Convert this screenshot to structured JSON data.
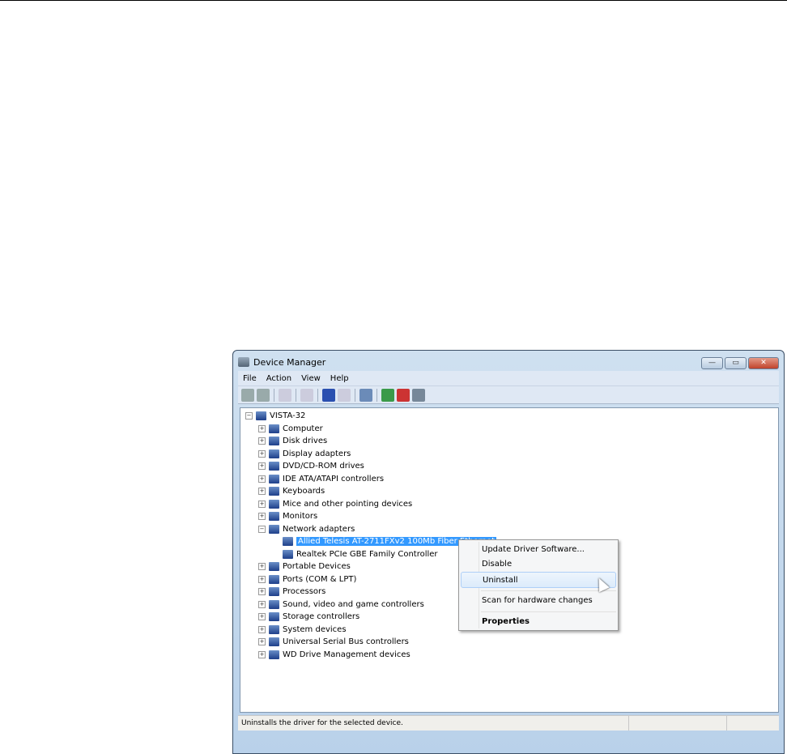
{
  "window": {
    "title": "Device Manager",
    "buttons": [
      "minimize",
      "maximize",
      "close"
    ]
  },
  "menu": [
    "File",
    "Action",
    "View",
    "Help"
  ],
  "toolbar": [
    "back-icon",
    "forward-icon",
    "show-hide-console-tree-icon",
    "properties-icon",
    "help-icon",
    "action-pane-icon",
    "scan-hardware-icon",
    "update-driver-icon",
    "uninstall-icon",
    "disable-icon"
  ],
  "tree": {
    "root": "VISTA-32",
    "items": [
      {
        "label": "Computer",
        "expanded": false
      },
      {
        "label": "Disk drives",
        "expanded": false
      },
      {
        "label": "Display adapters",
        "expanded": false
      },
      {
        "label": "DVD/CD-ROM drives",
        "expanded": false
      },
      {
        "label": "IDE ATA/ATAPI controllers",
        "expanded": false
      },
      {
        "label": "Keyboards",
        "expanded": false
      },
      {
        "label": "Mice and other pointing devices",
        "expanded": false
      },
      {
        "label": "Monitors",
        "expanded": false
      },
      {
        "label": "Network adapters",
        "expanded": true,
        "children": [
          "Allied Telesis AT-2711FXv2 100Mb Fiber Ethernet",
          "Realtek PCIe GBE Family Controller"
        ]
      },
      {
        "label": "Portable Devices",
        "expanded": false
      },
      {
        "label": "Ports (COM & LPT)",
        "expanded": false
      },
      {
        "label": "Processors",
        "expanded": false
      },
      {
        "label": "Sound, video and game controllers",
        "expanded": false
      },
      {
        "label": "Storage controllers",
        "expanded": false
      },
      {
        "label": "System devices",
        "expanded": false
      },
      {
        "label": "Universal Serial Bus controllers",
        "expanded": false
      },
      {
        "label": "WD Drive Management devices",
        "expanded": false
      }
    ]
  },
  "context_menu": {
    "items": [
      "Update Driver Software...",
      "Disable",
      "Uninstall",
      "Scan for hardware changes",
      "Properties"
    ],
    "highlighted": "Uninstall"
  },
  "status": "Uninstalls the driver for the selected device.",
  "colors": {
    "selection": "#3399ff",
    "close_button": "#c0432b"
  }
}
